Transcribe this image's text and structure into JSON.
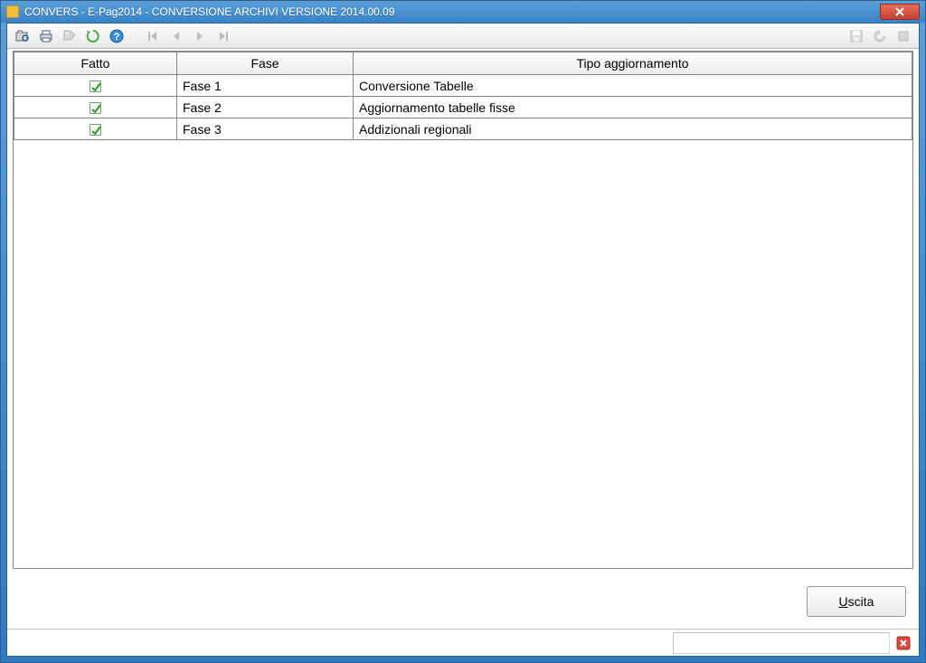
{
  "window": {
    "title": "CONVERS  - E-Pag2014  -  CONVERSIONE ARCHIVI VERSIONE 2014.00.09"
  },
  "toolbar": {
    "open_icon": "open",
    "print_icon": "print",
    "tag_icon": "tag",
    "refresh_icon": "refresh",
    "help_icon": "help",
    "nav_first_icon": "first",
    "nav_prev_icon": "prev",
    "nav_next_icon": "next",
    "nav_last_icon": "last",
    "save_icon": "save",
    "undo_icon": "undo",
    "stop_icon": "stop"
  },
  "grid": {
    "columns": {
      "fatto": "Fatto",
      "fase": "Fase",
      "tipo": "Tipo aggiornamento"
    },
    "rows": [
      {
        "fatto": true,
        "fase": "Fase  1",
        "tipo": "Conversione Tabelle"
      },
      {
        "fatto": true,
        "fase": "Fase  2",
        "tipo": "Aggiornamento tabelle fisse"
      },
      {
        "fatto": true,
        "fase": "Fase  3",
        "tipo": "Addizionali regionali"
      }
    ]
  },
  "footer": {
    "exit_label": "Uscita",
    "exit_prefix": "U",
    "exit_rest": "scita"
  }
}
